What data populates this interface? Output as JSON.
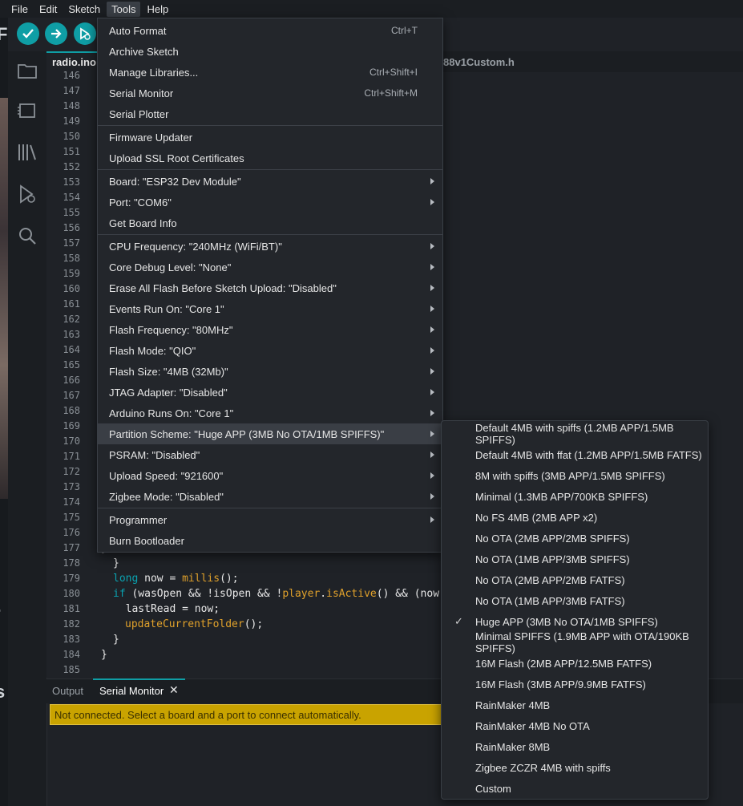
{
  "menubar": {
    "items": [
      "File",
      "Edit",
      "Sketch",
      "Tools",
      "Help"
    ],
    "active": "Tools"
  },
  "toolbar": {
    "verify": "verify-button",
    "upload": "upload-button",
    "debug": "debug-button"
  },
  "editor": {
    "tabs": [
      "radio.ino",
      "88v1Custom.h"
    ],
    "line_numbers": [
      "146",
      "147",
      "148",
      "149",
      "150",
      "151",
      "152",
      "153",
      "154",
      "155",
      "156",
      "157",
      "158",
      "159",
      "160",
      "161",
      "162",
      "163",
      "164",
      "165",
      "166",
      "167",
      "168",
      "169",
      "170",
      "171",
      "172",
      "173",
      "174",
      "175",
      "176",
      "177",
      "178",
      "179",
      "180",
      "181",
      "182",
      "183",
      "184",
      "185"
    ],
    "code": {
      "l177": "}",
      "l178_brace": "}",
      "l179_kw": "long",
      "l179_mid": " now = ",
      "l179_fn": "millis",
      "l179_end": "();",
      "l180_kw": "if",
      "l180_a": " (wasOpen && !isOpen && !",
      "l180_obj": "player",
      "l180_dot": ".",
      "l180_fn": "isActive",
      "l180_end": "() && (now",
      "l181": "  lastRead = now;",
      "l182_fn": "updateCurrentFolder",
      "l182_end": "();",
      "l183": "}",
      "l184": "}"
    }
  },
  "panel": {
    "tabs": [
      "Output",
      "Serial Monitor"
    ],
    "active": "Serial Monitor",
    "alert": "Not connected. Select a board and a port to connect automatically."
  },
  "tools_menu": {
    "groups": [
      [
        {
          "label": "Auto Format",
          "shortcut": "Ctrl+T"
        },
        {
          "label": "Archive Sketch",
          "shortcut": ""
        },
        {
          "label": "Manage Libraries...",
          "shortcut": "Ctrl+Shift+I"
        },
        {
          "label": "Serial Monitor",
          "shortcut": "Ctrl+Shift+M"
        },
        {
          "label": "Serial Plotter",
          "shortcut": ""
        }
      ],
      [
        {
          "label": "Firmware Updater",
          "shortcut": ""
        },
        {
          "label": "Upload SSL Root Certificates",
          "shortcut": ""
        }
      ],
      [
        {
          "label": "Board: \"ESP32 Dev Module\"",
          "submenu": true
        },
        {
          "label": "Port: \"COM6\"",
          "submenu": true
        },
        {
          "label": "Get Board Info",
          "submenu": false
        }
      ],
      [
        {
          "label": "CPU Frequency: \"240MHz (WiFi/BT)\"",
          "submenu": true
        },
        {
          "label": "Core Debug Level: \"None\"",
          "submenu": true
        },
        {
          "label": "Erase All Flash Before Sketch Upload: \"Disabled\"",
          "submenu": true
        },
        {
          "label": "Events Run On: \"Core 1\"",
          "submenu": true
        },
        {
          "label": "Flash Frequency: \"80MHz\"",
          "submenu": true
        },
        {
          "label": "Flash Mode: \"QIO\"",
          "submenu": true
        },
        {
          "label": "Flash Size: \"4MB (32Mb)\"",
          "submenu": true
        },
        {
          "label": "JTAG Adapter: \"Disabled\"",
          "submenu": true
        },
        {
          "label": "Arduino Runs On: \"Core 1\"",
          "submenu": true
        },
        {
          "label": "Partition Scheme: \"Huge APP (3MB No OTA/1MB SPIFFS)\"",
          "submenu": true,
          "highlighted": true
        },
        {
          "label": "PSRAM: \"Disabled\"",
          "submenu": true
        },
        {
          "label": "Upload Speed: \"921600\"",
          "submenu": true
        },
        {
          "label": "Zigbee Mode: \"Disabled\"",
          "submenu": true
        }
      ],
      [
        {
          "label": "Programmer",
          "submenu": true
        },
        {
          "label": "Burn Bootloader",
          "submenu": false
        }
      ]
    ]
  },
  "partition_submenu": {
    "selected": "Huge APP (3MB No OTA/1MB SPIFFS)",
    "items": [
      "Default 4MB with spiffs (1.2MB APP/1.5MB SPIFFS)",
      "Default 4MB with ffat (1.2MB APP/1.5MB FATFS)",
      "8M with spiffs (3MB APP/1.5MB SPIFFS)",
      "Minimal (1.3MB APP/700KB SPIFFS)",
      "No FS 4MB (2MB APP x2)",
      "No OTA (2MB APP/2MB SPIFFS)",
      "No OTA (1MB APP/3MB SPIFFS)",
      "No OTA (2MB APP/2MB FATFS)",
      "No OTA (1MB APP/3MB FATFS)",
      "Huge APP (3MB No OTA/1MB SPIFFS)",
      "Minimal SPIFFS (1.9MB APP with OTA/190KB SPIFFS)",
      "16M Flash (2MB APP/12.5MB FATFS)",
      "16M Flash (3MB APP/9.9MB FATFS)",
      "RainMaker 4MB",
      "RainMaker 4MB No OTA",
      "RainMaker 8MB",
      "Zigbee ZCZR 4MB with spiffs",
      "Custom"
    ],
    "check_glyph": "✓"
  },
  "edge_text": {
    "a": "a",
    "b": "i",
    "c": "s",
    "d": "r",
    "e": "a",
    "f": "s",
    "g": "F"
  },
  "colors": {
    "accent": "#0f9ea5",
    "alert_bg": "#c9a300",
    "background": "#1f2227",
    "menu_bg": "#23262b"
  }
}
